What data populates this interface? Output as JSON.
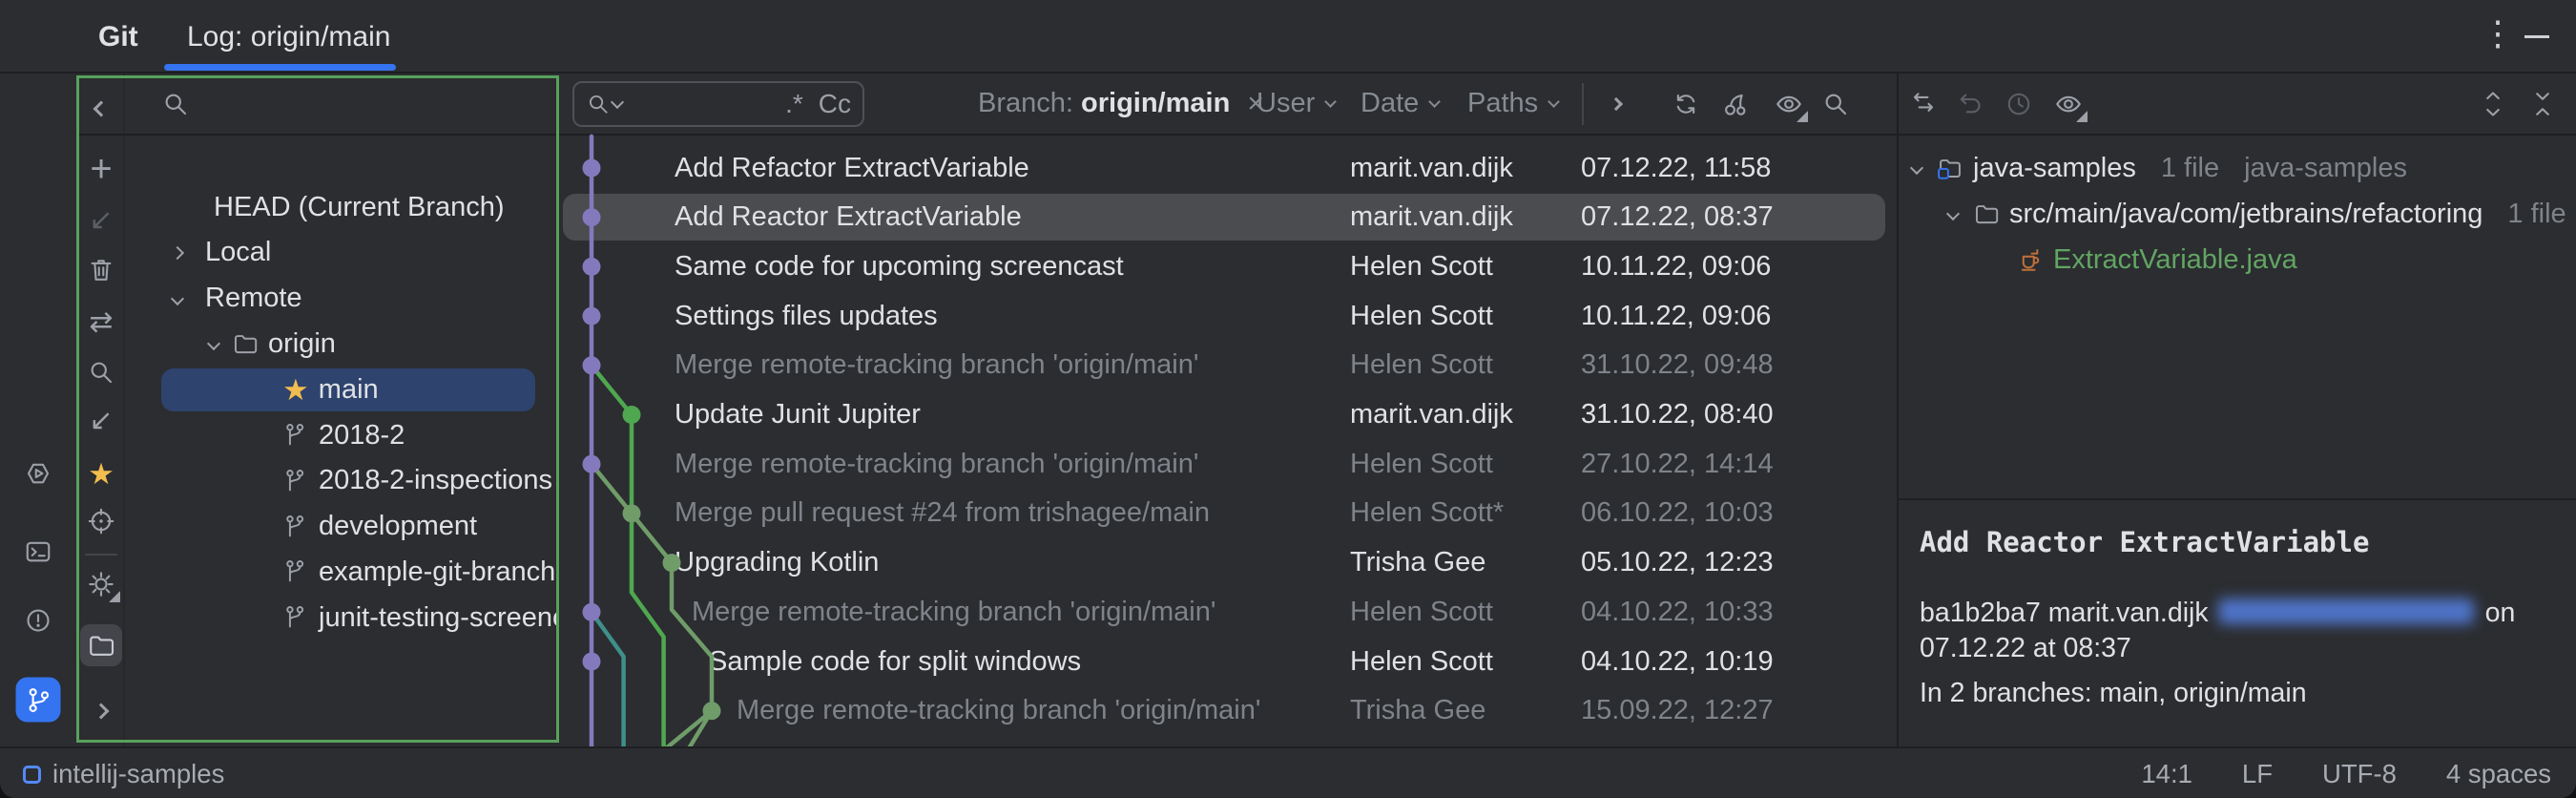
{
  "colors": {
    "accent": "#3574f0",
    "selection_blue": "#2e436e",
    "commit_selection": "#4a4c50",
    "frame_green": "#58a15c",
    "star_yellow": "#f2bd4e",
    "added_file_green": "#62a563",
    "java_orange": "#c0713a",
    "graph_purple": "#8579bd",
    "graph_green": "#4fa750",
    "graph_sage": "#6f9c69",
    "graph_teal": "#3f8f8a"
  },
  "title_bar": {
    "tool": "Git",
    "tab": "Log: origin/main"
  },
  "activity_bar": [
    {
      "name": "services",
      "icon": "hex-play"
    },
    {
      "name": "terminal",
      "icon": "terminal"
    },
    {
      "name": "problems",
      "icon": "error"
    },
    {
      "name": "version-control",
      "icon": "vcs",
      "active": true
    }
  ],
  "branch_toolbar": [
    {
      "name": "hide-panel",
      "icon": "chevron-left"
    },
    {
      "name": "new-branch",
      "icon": "plus"
    },
    {
      "name": "diff-preview",
      "icon": "arrow-dl",
      "disabled": true
    },
    {
      "name": "delete-branch",
      "icon": "trash"
    },
    {
      "name": "fetch",
      "icon": "merge-arrows"
    },
    {
      "name": "search-branch",
      "icon": "search"
    },
    {
      "name": "navigate-log",
      "icon": "navigate"
    },
    {
      "name": "favorite-branches",
      "icon": "star"
    },
    {
      "name": "locate-branch",
      "icon": "target"
    },
    {
      "name": "settings",
      "icon": "gear",
      "has_caret": true
    },
    {
      "name": "group-by-directory",
      "icon": "folder",
      "selected": true
    },
    {
      "name": "expand-panel",
      "icon": "chevron-right"
    }
  ],
  "branches": {
    "search_value": "",
    "tree": [
      {
        "label": "HEAD (Current Branch)",
        "pad": 83
      },
      {
        "label": "Local",
        "pad": 50,
        "chev": "r"
      },
      {
        "label": "Remote",
        "pad": 50,
        "chev": "d"
      },
      {
        "label": "origin",
        "pad": 88,
        "chev": "d",
        "icon": "folder"
      },
      {
        "label": "main",
        "pad": 165,
        "icon": "star",
        "selected": true
      },
      {
        "label": "2018-2",
        "pad": 165,
        "icon": "branch"
      },
      {
        "label": "2018-2-inspections",
        "pad": 165,
        "icon": "branch"
      },
      {
        "label": "development",
        "pad": 165,
        "icon": "branch"
      },
      {
        "label": "example-git-branch",
        "pad": 165,
        "icon": "branch"
      },
      {
        "label": "junit-testing-screenc",
        "pad": 165,
        "icon": "branch"
      }
    ]
  },
  "log": {
    "search_value": "",
    "regex_label": ".*",
    "case_label": "Cc",
    "branch_filter_label": "Branch:",
    "branch_filter_value": "origin/main",
    "close_label": "×",
    "user_filter": "User",
    "date_filter": "Date",
    "paths_filter": "Paths",
    "toolbar": [
      {
        "name": "show-more-filters",
        "icon": "chevron-right-sm"
      },
      {
        "name": "refresh-log",
        "icon": "refresh"
      },
      {
        "name": "cherry-pick",
        "icon": "cherry"
      },
      {
        "name": "eye-options",
        "icon": "eye",
        "has_caret": true
      },
      {
        "name": "go-to-hash",
        "icon": "search"
      }
    ],
    "commits": [
      {
        "message": "Add Refactor ExtractVariable",
        "author": "marit.van.dijk",
        "date": "07.12.22, 11:58"
      },
      {
        "message": "Add Reactor ExtractVariable",
        "author": "marit.van.dijk",
        "date": "07.12.22, 08:37",
        "selected": true
      },
      {
        "message": "Same code for upcoming screencast",
        "author": "Helen Scott",
        "date": "10.11.22, 09:06"
      },
      {
        "message": "Settings files updates",
        "author": "Helen Scott",
        "date": "10.11.22, 09:06"
      },
      {
        "message": "Merge remote-tracking branch 'origin/main'",
        "author": "Helen Scott",
        "date": "31.10.22, 09:48",
        "dim": true
      },
      {
        "message": "Update Junit Jupiter",
        "author": "marit.van.dijk",
        "date": "31.10.22, 08:40"
      },
      {
        "message": "Merge remote-tracking branch 'origin/main'",
        "author": "Helen Scott",
        "date": "27.10.22, 14:14",
        "dim": true
      },
      {
        "message": "Merge pull request #24 from trishagee/main",
        "author": "Helen Scott*",
        "date": "06.10.22, 10:03",
        "dim": true
      },
      {
        "message": "Upgrading Kotlin",
        "author": "Trisha Gee",
        "date": "05.10.22, 12:23"
      },
      {
        "message": "Merge remote-tracking branch 'origin/main'",
        "author": "Helen Scott",
        "date": "04.10.22, 10:33",
        "dim": true,
        "indent": 18
      },
      {
        "message": "Sample code for split windows",
        "author": "Helen Scott",
        "date": "04.10.22, 10:19",
        "indent": 36
      },
      {
        "message": "Merge remote-tracking branch 'origin/main'",
        "author": "Trisha Gee",
        "date": "15.09.22, 12:27",
        "dim": true,
        "indent": 65
      }
    ]
  },
  "graph": {
    "edges": [
      {
        "c": "purple",
        "pts": [
          [
            1,
            0.36
          ],
          [
            1,
            12.8
          ]
        ]
      },
      {
        "c": "green",
        "pts": [
          [
            1,
            5
          ],
          [
            2,
            6
          ],
          [
            2,
            9.6
          ],
          [
            2.8,
            10.5
          ],
          [
            2.8,
            12.8
          ]
        ]
      },
      {
        "c": "sage",
        "pts": [
          [
            1,
            7
          ],
          [
            2,
            8
          ],
          [
            3,
            9
          ]
        ]
      },
      {
        "c": "sage",
        "pts": [
          [
            3,
            9
          ],
          [
            3,
            9.95
          ],
          [
            4,
            10.9
          ],
          [
            4,
            12
          ]
        ]
      },
      {
        "c": "teal",
        "pts": [
          [
            1,
            10
          ],
          [
            1.8,
            10.9
          ],
          [
            1.8,
            12.8
          ]
        ]
      },
      {
        "c": "sage",
        "pts": [
          [
            4,
            12
          ],
          [
            2.8,
            12.8
          ]
        ]
      },
      {
        "c": "sage",
        "pts": [
          [
            4,
            12
          ],
          [
            3.4,
            12.8
          ]
        ]
      }
    ],
    "nodes": [
      {
        "row": 1,
        "col": 1,
        "c": "purple"
      },
      {
        "row": 2,
        "col": 1,
        "c": "purple"
      },
      {
        "row": 3,
        "col": 1,
        "c": "purple"
      },
      {
        "row": 4,
        "col": 1,
        "c": "purple"
      },
      {
        "row": 5,
        "col": 1,
        "c": "purple"
      },
      {
        "row": 6,
        "col": 2,
        "c": "green"
      },
      {
        "row": 7,
        "col": 1,
        "c": "purple"
      },
      {
        "row": 8,
        "col": 2,
        "c": "sage"
      },
      {
        "row": 9,
        "col": 3,
        "c": "sage"
      },
      {
        "row": 10,
        "col": 1,
        "c": "purple"
      },
      {
        "row": 11,
        "col": 1,
        "c": "purple"
      },
      {
        "row": 12,
        "col": 4,
        "c": "sage"
      }
    ]
  },
  "details": {
    "toolbar": [
      {
        "name": "compare-with-local",
        "icon": "compare"
      },
      {
        "name": "rollback",
        "icon": "undo",
        "disabled": true
      },
      {
        "name": "show-history",
        "icon": "clock",
        "disabled": true
      },
      {
        "name": "preview-diff",
        "icon": "eye",
        "has_caret": true
      }
    ],
    "toolbar_right": [
      {
        "name": "expand-all",
        "icon": "expand"
      },
      {
        "name": "collapse-all",
        "icon": "collapse"
      }
    ],
    "files": [
      {
        "label": "java-samples",
        "icon": "module",
        "chev": true,
        "meta": [
          "1 file",
          "java-samples"
        ],
        "pad": 14
      },
      {
        "label": "src/main/java/com/jetbrains/refactoring",
        "icon": "folder",
        "chev": true,
        "meta": [
          "1 file"
        ],
        "pad": 52
      },
      {
        "label": "ExtractVariable.java",
        "icon": "java",
        "added": true,
        "pad": 124
      }
    ],
    "commit": {
      "title": "Add Reactor ExtractVariable",
      "hash": "ba1b2ba7",
      "author": "marit.van.dijk",
      "on_word": "on",
      "datetime": "07.12.22 at 08:37",
      "branches": "In 2 branches: main, origin/main"
    }
  },
  "status_bar": {
    "project": "intellij-samples",
    "items": [
      "14:1",
      "LF",
      "UTF-8",
      "4 spaces"
    ]
  },
  "window_controls": {
    "kebab": "⋮"
  }
}
